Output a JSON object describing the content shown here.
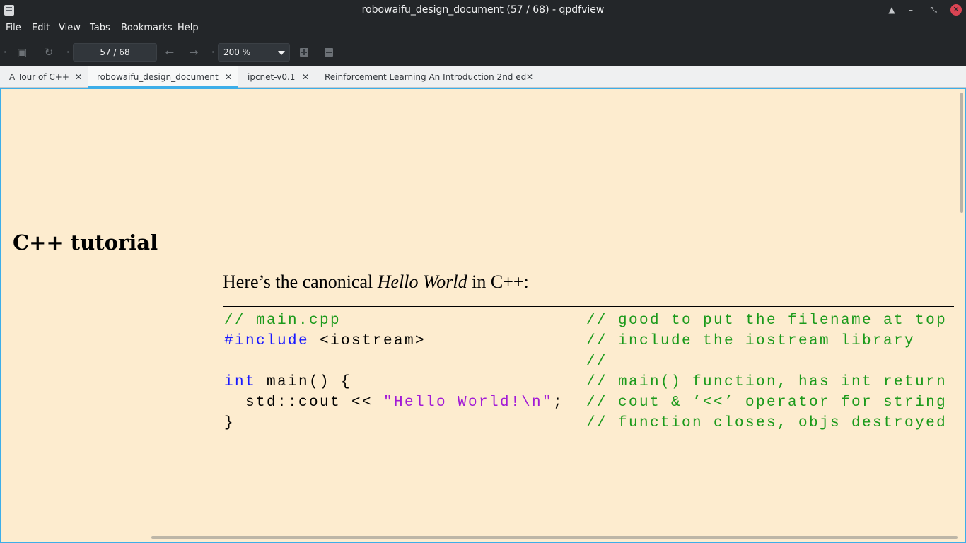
{
  "window": {
    "title": "robowaifu_design_document (57 / 68) - qpdfview",
    "controls": {
      "keep_above": "▲",
      "minimize": "–",
      "restore": "⤡",
      "close": "✕"
    }
  },
  "menu": [
    "File",
    "Edit",
    "View",
    "Tabs",
    "Bookmarks",
    "Help"
  ],
  "toolbar": {
    "page_field": "57 / 68",
    "zoom": "200 %",
    "icons": [
      "open-icon",
      "refresh-icon",
      "back-arrow-icon",
      "forward-arrow-icon",
      "zoom-in-icon",
      "zoom-out-icon"
    ]
  },
  "tabs": [
    {
      "label": "A Tour of C++",
      "active": false
    },
    {
      "label": "robowaifu_design_document",
      "active": true
    },
    {
      "label": "ipcnet-v0.1",
      "active": false
    },
    {
      "label": "Reinforcement Learning An Introduction 2nd ed",
      "active": false
    }
  ],
  "tab_close_glyph": "✕",
  "document": {
    "heading": "C++ tutorial",
    "para_pre": "Here’s the canonical ",
    "para_em": "Hello World",
    "para_post": " in C++:",
    "code_left": [
      {
        "text": "// main.cpp",
        "kind": "comment"
      },
      {
        "kw": "#include",
        "rest": " <iostream>"
      },
      {
        "text": "",
        "kind": "plain"
      },
      {
        "kw": "int",
        "rest": " main() {"
      },
      {
        "pre": "  std::cout << ",
        "str": "\"Hello World!\\n\"",
        "post": ";"
      },
      {
        "text": "}",
        "kind": "plain"
      }
    ],
    "code_right": [
      "// good to put the filename at top",
      "// include the iostream library",
      "//",
      "// main() function, has int return",
      "// cout & ’<<’ operator for string",
      "// function closes, objs destroyed"
    ]
  },
  "colors": {
    "page_bg": "#fdeccf",
    "comment": "#1b9a1b",
    "keyword": "#1a1aff",
    "string": "#a21ad6",
    "accent": "#3daee9"
  }
}
